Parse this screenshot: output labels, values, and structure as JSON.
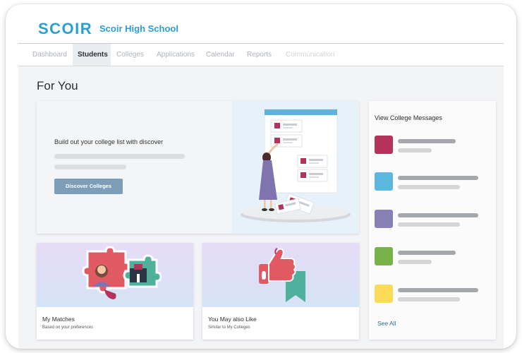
{
  "header": {
    "logo_text": "SCOIR",
    "school_name": "Scoir High School"
  },
  "tabs": [
    {
      "label": "Dashboard",
      "state": "inactive"
    },
    {
      "label": "Students",
      "state": "active"
    },
    {
      "label": "Colleges",
      "state": "inactive"
    },
    {
      "label": "Applications",
      "state": "inactive"
    },
    {
      "label": "Calendar",
      "state": "inactive"
    },
    {
      "label": "Reports",
      "state": "inactive"
    },
    {
      "label": "Communication",
      "state": "disabled"
    }
  ],
  "main": {
    "title": "For You",
    "hero": {
      "heading": "Build out your college list with discover",
      "button_label": "Discover Colleges",
      "illustration": "woman-pinning-colleges-illustration"
    },
    "messages": {
      "title": "View College Messages",
      "see_all_label": "See All",
      "items": [
        {
          "color": "#b5325b"
        },
        {
          "color": "#5cb8de"
        },
        {
          "color": "#8781b5"
        },
        {
          "color": "#7ab24a"
        },
        {
          "color": "#fbdb58"
        }
      ]
    },
    "cards": [
      {
        "title": "My Matches",
        "subtitle": "Based on your preferences",
        "illustration": "puzzle-pieces-icon"
      },
      {
        "title": "You May also Like",
        "subtitle": "Similar to My Colleges",
        "illustration": "thumbs-up-icon"
      }
    ]
  },
  "colors": {
    "brand": "#2b9ed4",
    "button": "#7d9eb8",
    "link": "#2e6fa1",
    "background": "#f3f4f6"
  }
}
